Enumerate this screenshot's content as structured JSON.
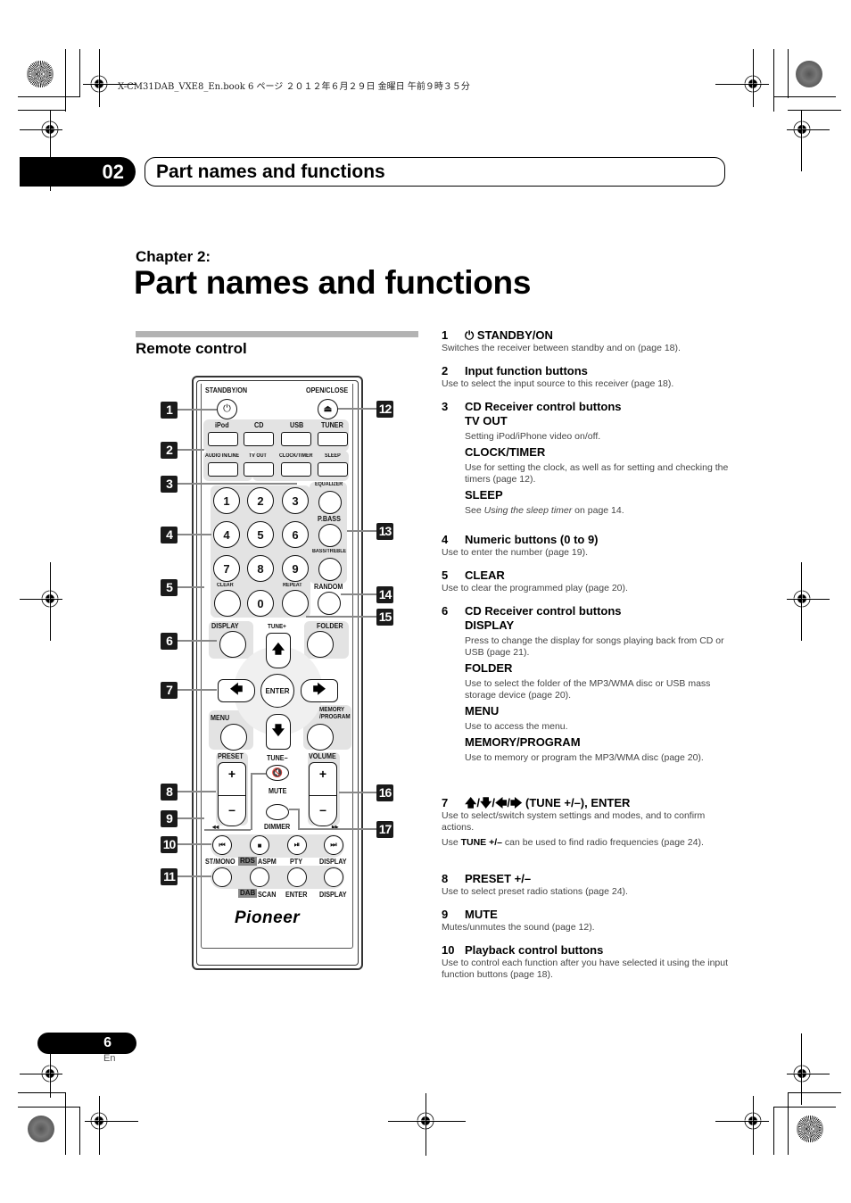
{
  "print_header": {
    "file_info": "X-CM31DAB_VXE8_En.book  6 ページ  ２０１２年６月２９日  金曜日  午前９時３５分"
  },
  "chapter_tab": {
    "number": "02",
    "title": "Part names and functions"
  },
  "chapter_label": "Chapter 2:",
  "page_title": "Part names and functions",
  "section_title": "Remote control",
  "remote": {
    "labels": {
      "standby_on": "STANDBY/ON",
      "open_close": "OPEN/CLOSE",
      "ipod": "iPod",
      "cd": "CD",
      "usb": "USB",
      "tuner": "TUNER",
      "audio_in_line": "AUDIO IN/LINE",
      "tv_out": "TV OUT",
      "clock_timer": "CLOCK/TIMER",
      "sleep": "SLEEP",
      "equalizer": "EQUALIZER",
      "p_bass": "P.BASS",
      "bass_treble": "BASS/TREBLE",
      "clear": "CLEAR",
      "repeat": "REPEAT",
      "random": "RANDOM",
      "display": "DISPLAY",
      "tune_plus": "TUNE+",
      "folder": "FOLDER",
      "enter": "ENTER",
      "menu": "MENU",
      "memory_program": "MEMORY\n/PROGRAM",
      "preset": "PRESET",
      "tune_minus": "TUNE–",
      "volume": "VOLUME",
      "mute": "MUTE",
      "dimmer": "DIMMER",
      "st_mono": "ST/MONO",
      "rds": "RDS",
      "aspm": "ASPM",
      "pty": "PTY",
      "display2": "DISPLAY",
      "dab": "DAB",
      "scan": "SCAN",
      "enter2": "ENTER",
      "display3": "DISPLAY",
      "plus": "+",
      "minus": "–",
      "rew": "◂◂",
      "ff": "▸▸"
    },
    "numeric_buttons": [
      "1",
      "2",
      "3",
      "4",
      "5",
      "6",
      "7",
      "8",
      "9",
      "0"
    ],
    "brand": "Pioneer",
    "callouts": [
      "1",
      "2",
      "3",
      "4",
      "5",
      "6",
      "7",
      "8",
      "9",
      "10",
      "11",
      "12",
      "13",
      "14",
      "15",
      "16",
      "17"
    ]
  },
  "descriptions": [
    {
      "num": "1",
      "title": "⏻ STANDBY/ON",
      "text": "Switches the receiver between standby and on (page 18)."
    },
    {
      "num": "2",
      "title": "Input function buttons",
      "text": "Use to select the input source to this receiver (page 18)."
    },
    {
      "num": "3",
      "title": "CD Receiver control buttons",
      "subs": [
        {
          "title": "TV OUT",
          "text": "Setting iPod/iPhone video on/off."
        },
        {
          "title": "CLOCK/TIMER",
          "text": "Use for setting the clock, as well as for setting and checking the timers (page 12)."
        },
        {
          "title": "SLEEP",
          "text_prefix": "See ",
          "text_italic": "Using the sleep timer",
          "text_suffix": " on page 14."
        }
      ]
    },
    {
      "num": "4",
      "title": "Numeric buttons (0 to 9)",
      "text": "Use to enter the number (page 19)."
    },
    {
      "num": "5",
      "title": "CLEAR",
      "text": "Use to clear the programmed play (page 20)."
    },
    {
      "num": "6",
      "title": "CD Receiver control buttons",
      "subs": [
        {
          "title": "DISPLAY",
          "text": "Press to change the display for songs playing back from CD or USB (page 21)."
        },
        {
          "title": "FOLDER",
          "text": "Use to select the folder of the MP3/WMA disc or USB mass storage device (page 20)."
        },
        {
          "title": "MENU",
          "text": "Use to access the menu."
        },
        {
          "title": "MEMORY/PROGRAM",
          "text": "Use to memory or program the MP3/WMA disc (page 20)."
        }
      ]
    },
    {
      "num": "7",
      "title": "🡅/🡇/🡄/🡆 (TUNE +/–), ENTER",
      "text": "Use to select/switch system settings and modes, and to confirm actions.",
      "text2_prefix": "Use ",
      "text2_bold": "TUNE +/–",
      "text2_suffix": " can be used to find radio frequencies (page 24)."
    },
    {
      "num": "8",
      "title": "PRESET +/–",
      "text": "Use to select preset radio stations (page 24)."
    },
    {
      "num": "9",
      "title": "MUTE",
      "text": "Mutes/unmutes the sound (page 12)."
    },
    {
      "num": "10",
      "title": "Playback control buttons",
      "text": "Use to control each function after you have selected it using the input function buttons (page 18)."
    }
  ],
  "footer": {
    "page_number": "6",
    "language": "En"
  }
}
